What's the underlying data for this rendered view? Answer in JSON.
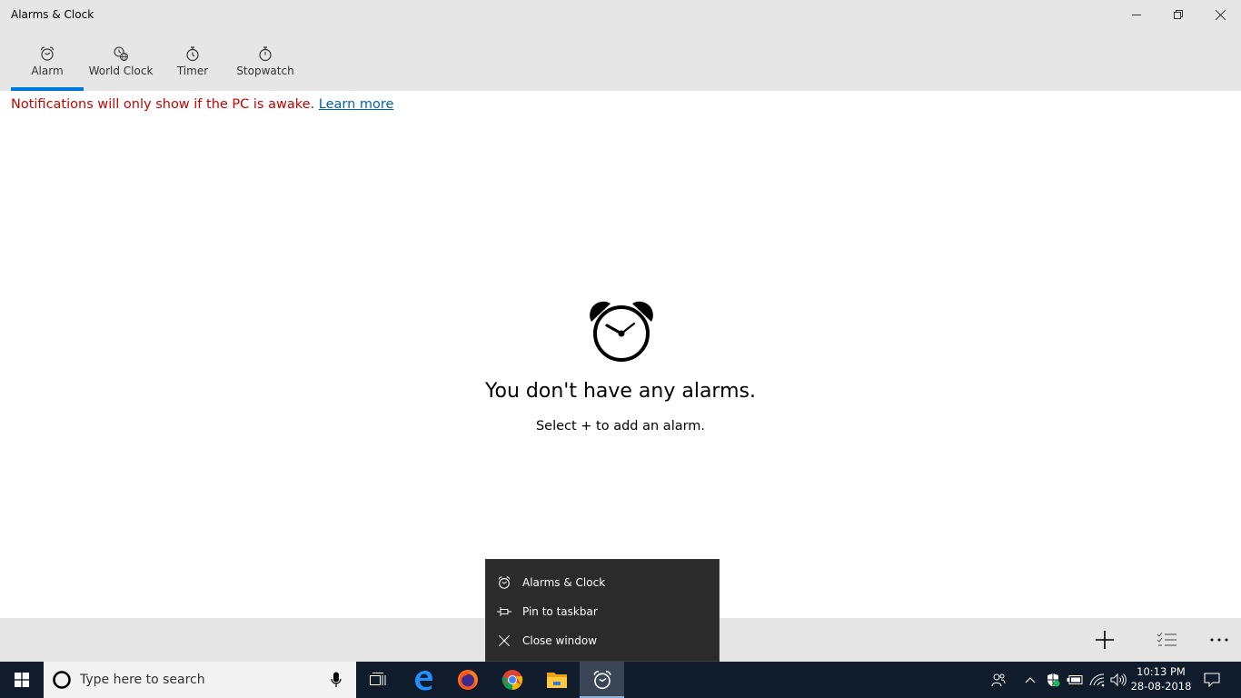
{
  "window": {
    "title": "Alarms & Clock"
  },
  "tabs": [
    {
      "label": "Alarm",
      "icon": "alarm-clock-icon",
      "selected": true
    },
    {
      "label": "World Clock",
      "icon": "world-clock-icon",
      "selected": false
    },
    {
      "label": "Timer",
      "icon": "timer-icon",
      "selected": false
    },
    {
      "label": "Stopwatch",
      "icon": "stopwatch-icon",
      "selected": false
    }
  ],
  "notice": {
    "text": "Notifications will only show if the PC is awake.",
    "link": "Learn more"
  },
  "empty_state": {
    "title": "You don't have any alarms.",
    "subtitle": "Select + to add an alarm."
  },
  "jump_list": {
    "items": [
      {
        "label": "Alarms & Clock",
        "icon": "alarm-clock-icon"
      },
      {
        "label": "Pin to taskbar",
        "icon": "pin-icon"
      },
      {
        "label": "Close window",
        "icon": "close-icon"
      }
    ]
  },
  "taskbar": {
    "search_placeholder": "Type here to search",
    "time": "10:13 PM",
    "date": "28-08-2018"
  },
  "colors": {
    "accent": "#0078d7",
    "notice": "#c50500",
    "link": "#0063b1",
    "chrome_gray": "#e6e6e6",
    "taskbar": "#101c2c"
  }
}
